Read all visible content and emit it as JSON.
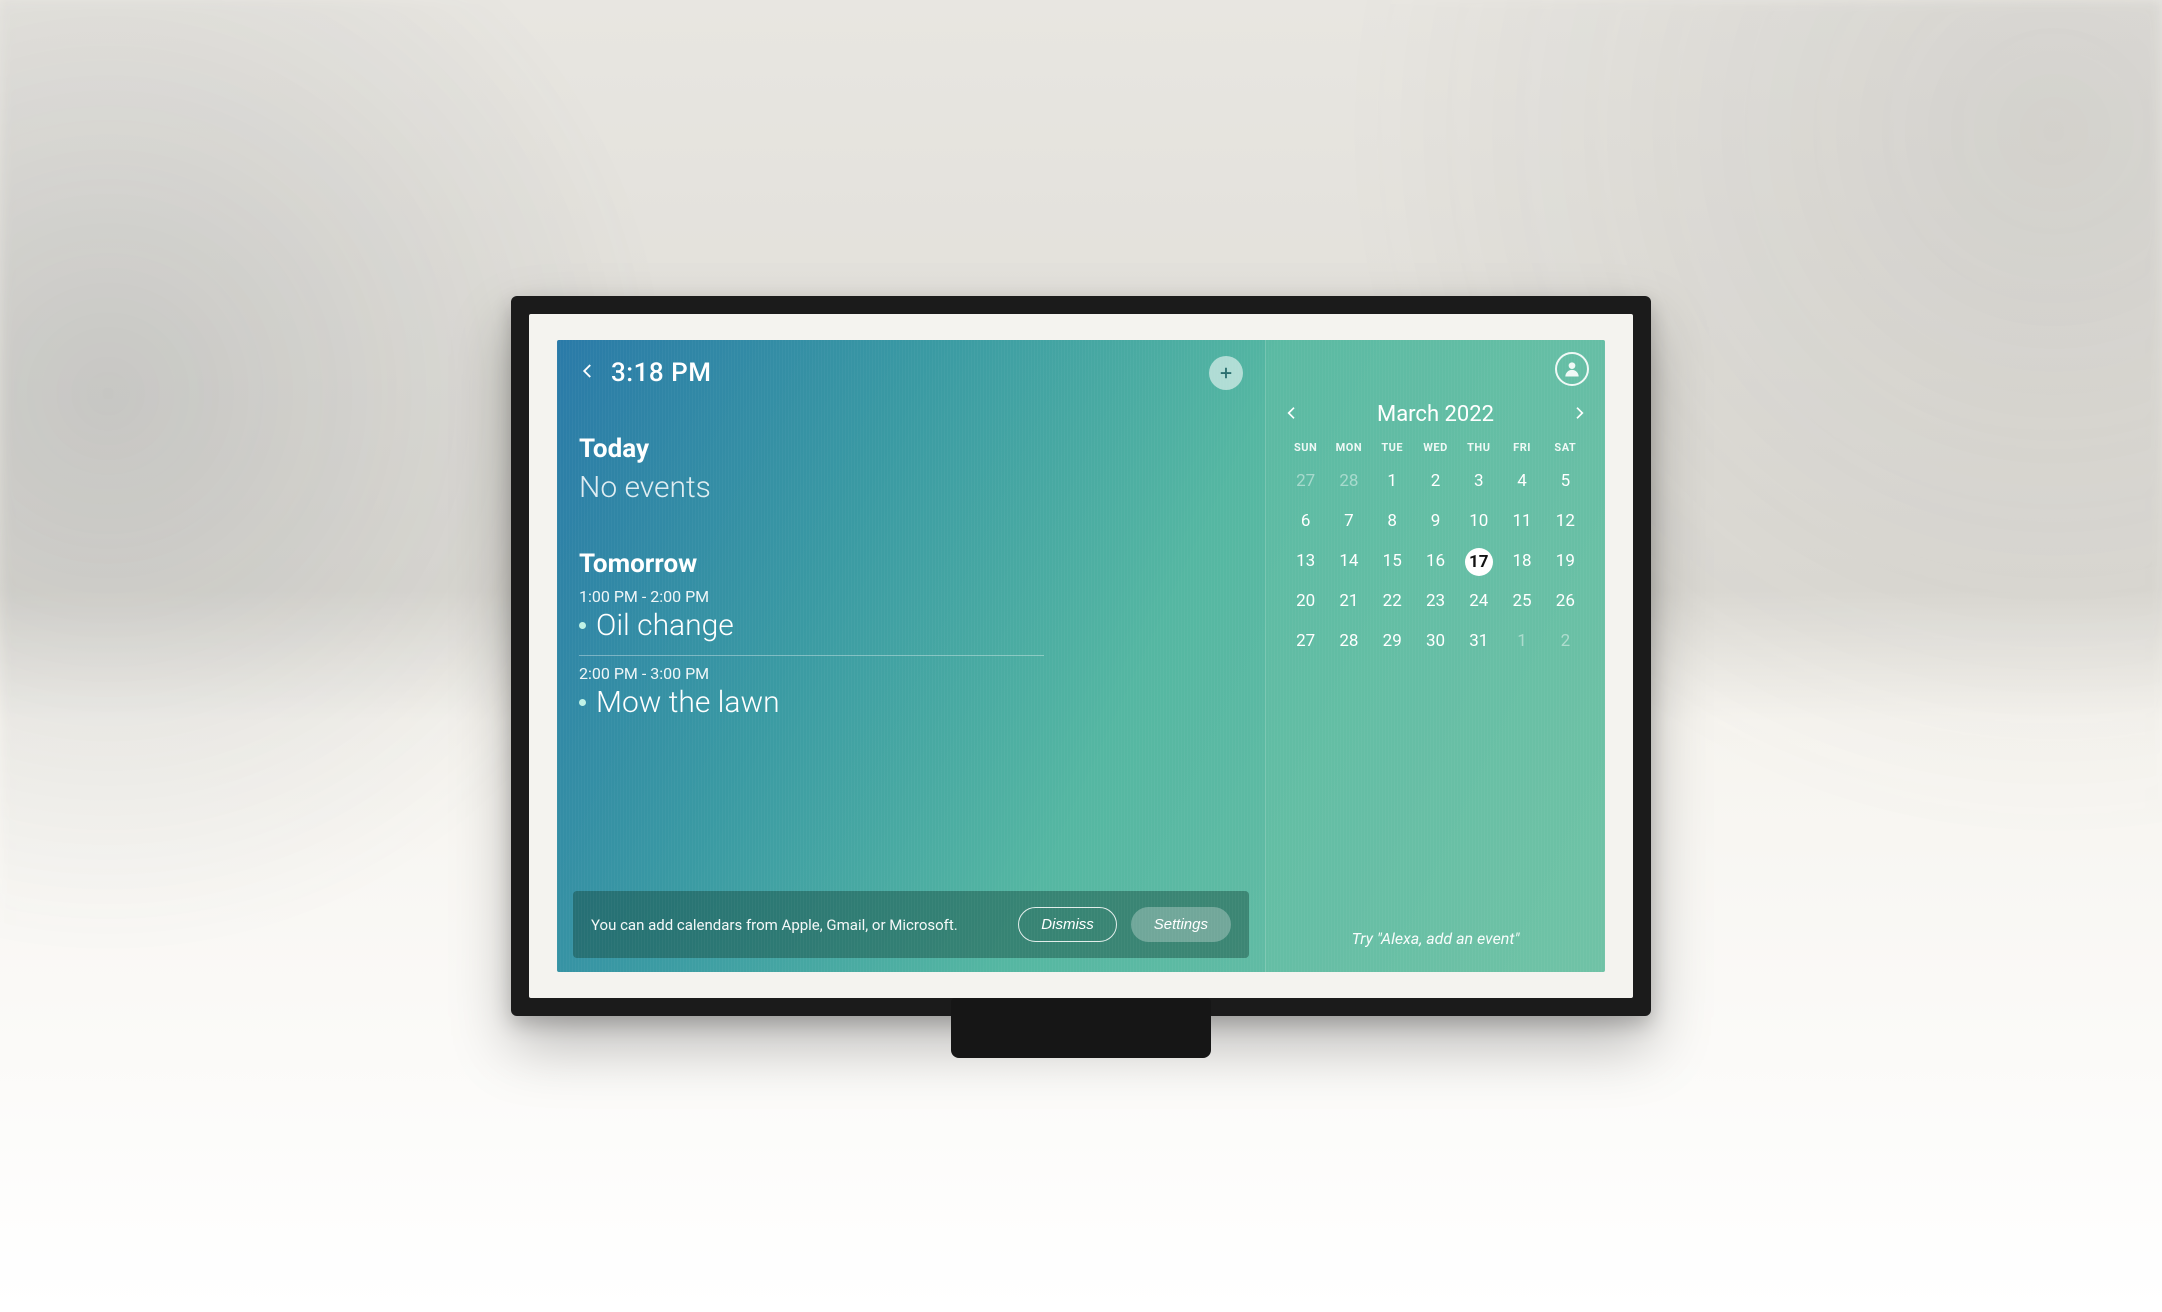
{
  "topbar": {
    "time": "3:18 PM"
  },
  "agenda": {
    "today": {
      "title": "Today",
      "empty_text": "No events"
    },
    "tomorrow": {
      "title": "Tomorrow",
      "events": [
        {
          "time": "1:00 PM - 2:00 PM",
          "title": "Oil change"
        },
        {
          "time": "2:00 PM - 3:00 PM",
          "title": "Mow the lawn"
        }
      ]
    }
  },
  "toast": {
    "message": "You can add calendars from Apple, Gmail, or Microsoft.",
    "dismiss": "Dismiss",
    "settings": "Settings"
  },
  "calendar": {
    "title": "March 2022",
    "dow": [
      "SUN",
      "MON",
      "TUE",
      "WED",
      "THU",
      "FRI",
      "SAT"
    ],
    "weeks": [
      [
        {
          "n": 27,
          "dim": true
        },
        {
          "n": 28,
          "dim": true
        },
        {
          "n": 1
        },
        {
          "n": 2
        },
        {
          "n": 3
        },
        {
          "n": 4
        },
        {
          "n": 5
        }
      ],
      [
        {
          "n": 6
        },
        {
          "n": 7
        },
        {
          "n": 8
        },
        {
          "n": 9
        },
        {
          "n": 10
        },
        {
          "n": 11
        },
        {
          "n": 12
        }
      ],
      [
        {
          "n": 13
        },
        {
          "n": 14
        },
        {
          "n": 15
        },
        {
          "n": 16
        },
        {
          "n": 17,
          "selected": true
        },
        {
          "n": 18
        },
        {
          "n": 19
        }
      ],
      [
        {
          "n": 20
        },
        {
          "n": 21
        },
        {
          "n": 22
        },
        {
          "n": 23
        },
        {
          "n": 24
        },
        {
          "n": 25
        },
        {
          "n": 26
        }
      ],
      [
        {
          "n": 27
        },
        {
          "n": 28
        },
        {
          "n": 29
        },
        {
          "n": 30
        },
        {
          "n": 31
        },
        {
          "n": 1,
          "dim": true
        },
        {
          "n": 2,
          "dim": true
        }
      ]
    ],
    "hint": "Try \"Alexa, add an event\""
  }
}
